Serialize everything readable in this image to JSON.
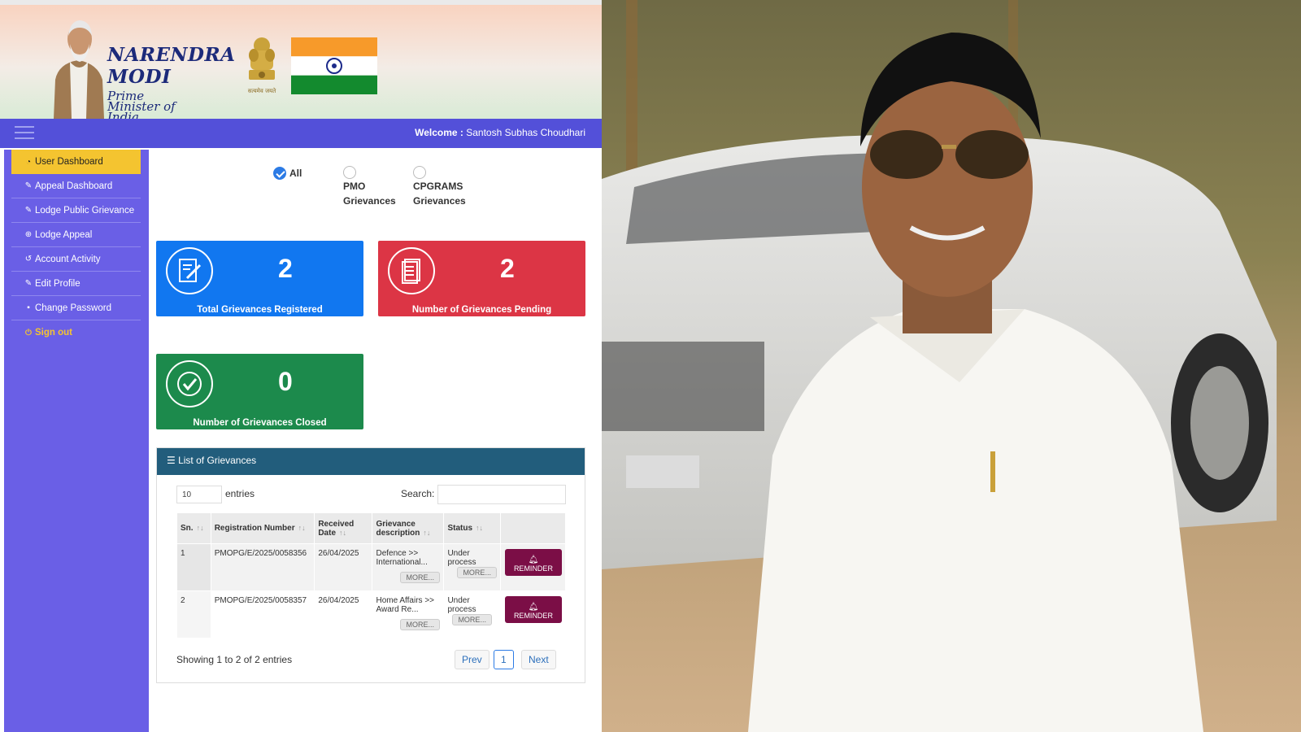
{
  "header": {
    "pm_name_line1": "NARENDRA",
    "pm_name_line2": "MODI",
    "pm_title": "Prime Minister of India",
    "emblem_motto": "सत्यमेव जयते"
  },
  "navbar": {
    "welcome_label": "Welcome :",
    "user_name": "Santosh Subhas Choudhari"
  },
  "sidebar": {
    "items": [
      {
        "label": "User Dashboard",
        "icon": "dashboard-icon"
      },
      {
        "label": "Appeal Dashboard",
        "icon": "edit-icon"
      },
      {
        "label": "Lodge Public Grievance",
        "icon": "edit-icon"
      },
      {
        "label": "Lodge Appeal",
        "icon": "plus-circle-icon"
      },
      {
        "label": "Account Activity",
        "icon": "history-icon"
      },
      {
        "label": "Edit Profile",
        "icon": "edit-icon"
      },
      {
        "label": "Change Password",
        "icon": "lock-icon"
      },
      {
        "label": "Sign out",
        "icon": "power-icon"
      }
    ],
    "active_color": "#f4c430"
  },
  "filters": {
    "all": "All",
    "pmo_line1": "PMO",
    "pmo_line2": "Grievances",
    "cpgrams_line1": "CPGRAMS",
    "cpgrams_line2": "Grievances"
  },
  "cards": {
    "total": {
      "value": "2",
      "label": "Total Grievances Registered",
      "color": "#1177f0"
    },
    "pending": {
      "value": "2",
      "label": "Number of Grievances Pending",
      "color": "#dc3545"
    },
    "closed": {
      "value": "0",
      "label": "Number of Grievances Closed",
      "color": "#1c8a4c"
    }
  },
  "grievances": {
    "title": "List of Grievances",
    "length_value": "10",
    "entries_label": "entries",
    "search_label": "Search:",
    "columns": [
      "Sn.",
      "Registration Number",
      "Received Date",
      "Grievance description",
      "Status",
      ""
    ],
    "rows": [
      {
        "sn": "1",
        "reg": "PMOPG/E/2025/0058356",
        "date": "26/04/2025",
        "desc": "Defence >> International...",
        "status": "Under process"
      },
      {
        "sn": "2",
        "reg": "PMOPG/E/2025/0058357",
        "date": "26/04/2025",
        "desc": "Home Affairs >> Award Re...",
        "status": "Under process"
      }
    ],
    "more_label": "MORE...",
    "reminder_label": "REMINDER",
    "info": "Showing 1 to 2 of 2 entries",
    "prev": "Prev",
    "page": "1",
    "next": "Next"
  }
}
